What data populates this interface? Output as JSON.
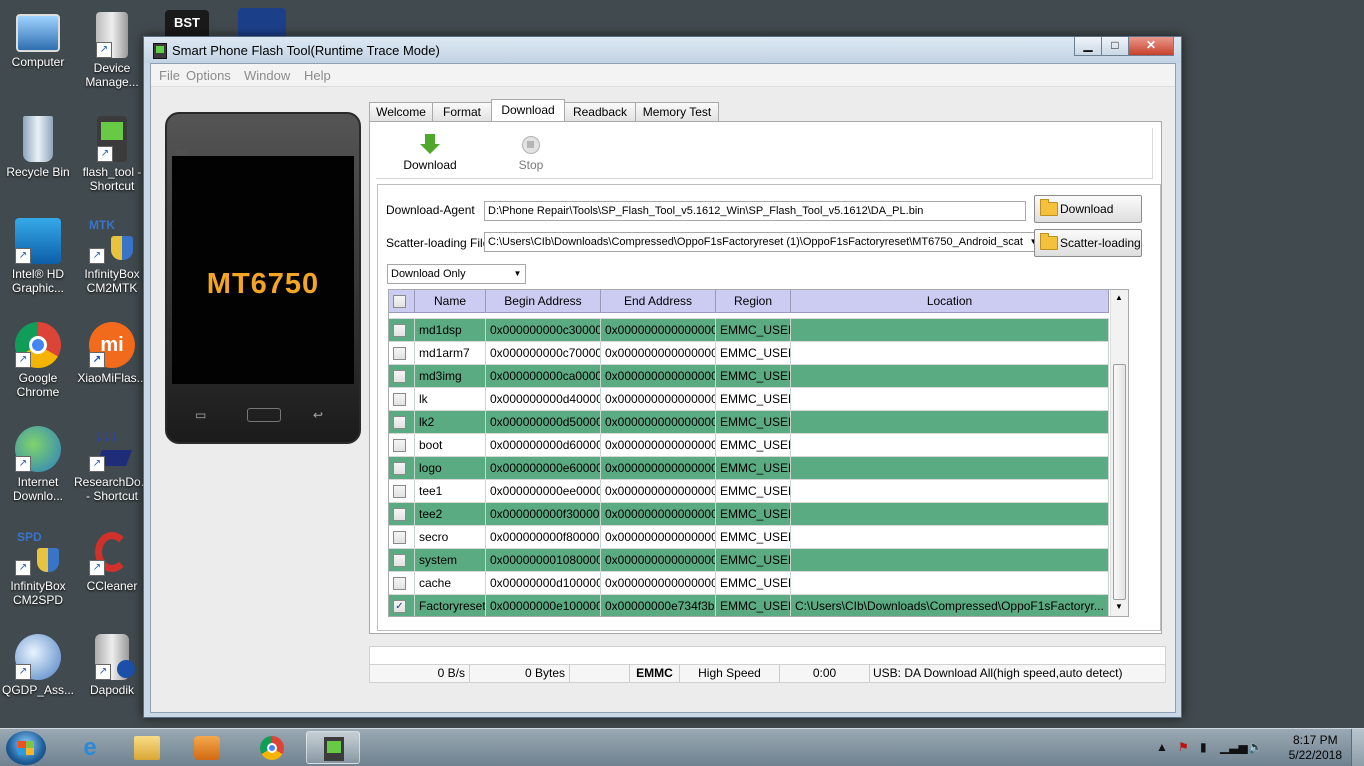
{
  "desktop": {
    "icons": [
      {
        "label": "Computer"
      },
      {
        "label": "Device Manage..."
      },
      {
        "label": "Recycle Bin"
      },
      {
        "label": "flash_tool - Shortcut"
      },
      {
        "label": "Intel® HD Graphic..."
      },
      {
        "label": "InfinityBox CM2MTK"
      },
      {
        "label": "Google Chrome"
      },
      {
        "label": "XiaoMiFlas..."
      },
      {
        "label": "Internet Downlo..."
      },
      {
        "label": "ResearchDo... - Shortcut"
      },
      {
        "label": "InfinityBox CM2SPD"
      },
      {
        "label": "CCleaner"
      },
      {
        "label": "QGDP_Ass..."
      },
      {
        "label": "Dapodik"
      }
    ],
    "partial_icons": {
      "bst": "BST",
      "mtk_prefix": "MTK",
      "spd_prefix": "SPD"
    }
  },
  "window": {
    "title": "Smart Phone Flash Tool(Runtime Trace Mode)",
    "controls": {
      "minimize": "▁",
      "maximize": "□",
      "close": "✕"
    }
  },
  "menu": [
    "File",
    "Options",
    "Window",
    "Help"
  ],
  "phone": {
    "chip": "MT6750",
    "tag": "BM"
  },
  "tabs": [
    {
      "label": "Welcome",
      "active": false
    },
    {
      "label": "Format",
      "active": false
    },
    {
      "label": "Download",
      "active": true
    },
    {
      "label": "Readback",
      "active": false
    },
    {
      "label": "Memory Test",
      "active": false
    }
  ],
  "toolbar": {
    "download_label": "Download",
    "stop_label": "Stop"
  },
  "download_agent": {
    "label": "Download-Agent",
    "value": "D:\\Phone Repair\\Tools\\SP_Flash_Tool_v5.1612_Win\\SP_Flash_Tool_v5.1612\\DA_PL.bin",
    "button": "Download Agent"
  },
  "scatter": {
    "label": "Scatter-loading File",
    "value": "C:\\Users\\CIb\\Downloads\\Compressed\\OppoF1sFactoryreset (1)\\OppoF1sFactoryreset\\MT6750_Android_scat",
    "button": "Scatter-loading"
  },
  "mode_select": {
    "value": "Download Only"
  },
  "table": {
    "headers": [
      "Name",
      "Begin Address",
      "End Address",
      "Region",
      "Location"
    ],
    "rows": [
      {
        "checked": false,
        "name": "md1dsp",
        "begin": "0x000000000c300000",
        "end": "0x0000000000000000",
        "region": "EMMC_USER",
        "location": ""
      },
      {
        "checked": false,
        "name": "md1arm7",
        "begin": "0x000000000c700000",
        "end": "0x0000000000000000",
        "region": "EMMC_USER",
        "location": ""
      },
      {
        "checked": false,
        "name": "md3img",
        "begin": "0x000000000ca00000",
        "end": "0x0000000000000000",
        "region": "EMMC_USER",
        "location": ""
      },
      {
        "checked": false,
        "name": "lk",
        "begin": "0x000000000d400000",
        "end": "0x0000000000000000",
        "region": "EMMC_USER",
        "location": ""
      },
      {
        "checked": false,
        "name": "lk2",
        "begin": "0x000000000d500000",
        "end": "0x0000000000000000",
        "region": "EMMC_USER",
        "location": ""
      },
      {
        "checked": false,
        "name": "boot",
        "begin": "0x000000000d600000",
        "end": "0x0000000000000000",
        "region": "EMMC_USER",
        "location": ""
      },
      {
        "checked": false,
        "name": "logo",
        "begin": "0x000000000e600000",
        "end": "0x0000000000000000",
        "region": "EMMC_USER",
        "location": ""
      },
      {
        "checked": false,
        "name": "tee1",
        "begin": "0x000000000ee00000",
        "end": "0x0000000000000000",
        "region": "EMMC_USER",
        "location": ""
      },
      {
        "checked": false,
        "name": "tee2",
        "begin": "0x000000000f300000",
        "end": "0x0000000000000000",
        "region": "EMMC_USER",
        "location": ""
      },
      {
        "checked": false,
        "name": "secro",
        "begin": "0x000000000f800000",
        "end": "0x0000000000000000",
        "region": "EMMC_USER",
        "location": ""
      },
      {
        "checked": false,
        "name": "system",
        "begin": "0x0000000010800000",
        "end": "0x0000000000000000",
        "region": "EMMC_USER",
        "location": ""
      },
      {
        "checked": false,
        "name": "cache",
        "begin": "0x00000000d1000000",
        "end": "0x0000000000000000",
        "region": "EMMC_USER",
        "location": ""
      },
      {
        "checked": true,
        "name": "Factoryreset",
        "begin": "0x00000000e1000000",
        "end": "0x00000000e734f3b7",
        "region": "EMMC_USER",
        "location": "C:\\Users\\CIb\\Downloads\\Compressed\\OppoF1sFactoryr..."
      }
    ]
  },
  "status": {
    "speed": "0 B/s",
    "bytes": "0 Bytes",
    "storage": "EMMC",
    "mode": "High Speed",
    "time": "0:00",
    "connection": "USB: DA Download All(high speed,auto detect)"
  },
  "taskbar": {
    "clock_time": "8:17 PM",
    "clock_date": "5/22/2018"
  },
  "colors": {
    "row_green": "#5aab82",
    "header_lavender": "#ccccf2",
    "chip_orange": "#f5a524"
  }
}
